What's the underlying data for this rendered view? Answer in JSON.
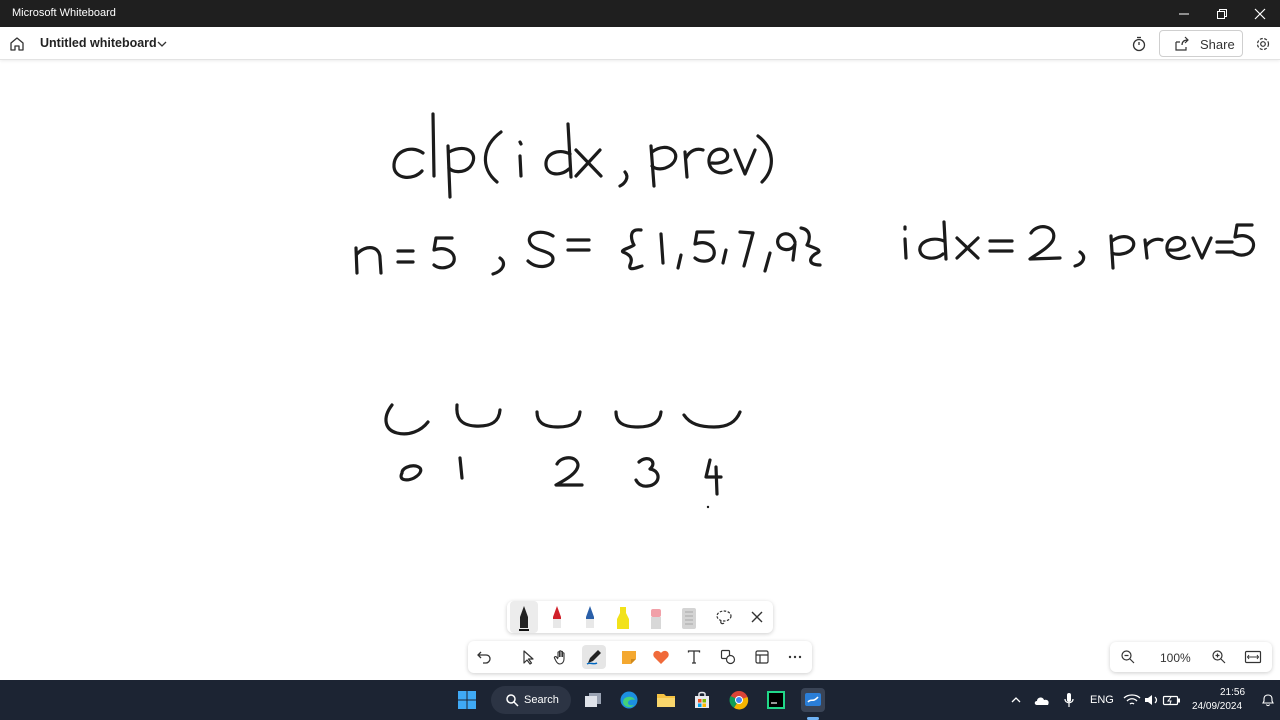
{
  "window": {
    "title": "Microsoft Whiteboard"
  },
  "appbar": {
    "doc_title": "Untitled whiteboard",
    "share_label": "Share"
  },
  "zoom": {
    "level": "100%"
  },
  "taskbar": {
    "search_label": "Search",
    "lang": "ENG",
    "time": "21:56",
    "date": "24/09/2024"
  },
  "colors": {
    "titlebar": "#1f1f1f",
    "taskbar": "#1c2433",
    "ink": "#1b1b1b",
    "accent": "#0067c0"
  },
  "icons": [
    "home-icon",
    "chevron-down-icon",
    "timer-icon",
    "share-icon",
    "gear-icon",
    "undo-icon",
    "select-icon",
    "hand-icon",
    "pen-icon",
    "sticky-note-icon",
    "reaction-icon",
    "text-icon",
    "shapes-icon",
    "template-icon",
    "more-icon",
    "zoom-out-icon",
    "zoom-in-icon",
    "fit-icon"
  ]
}
